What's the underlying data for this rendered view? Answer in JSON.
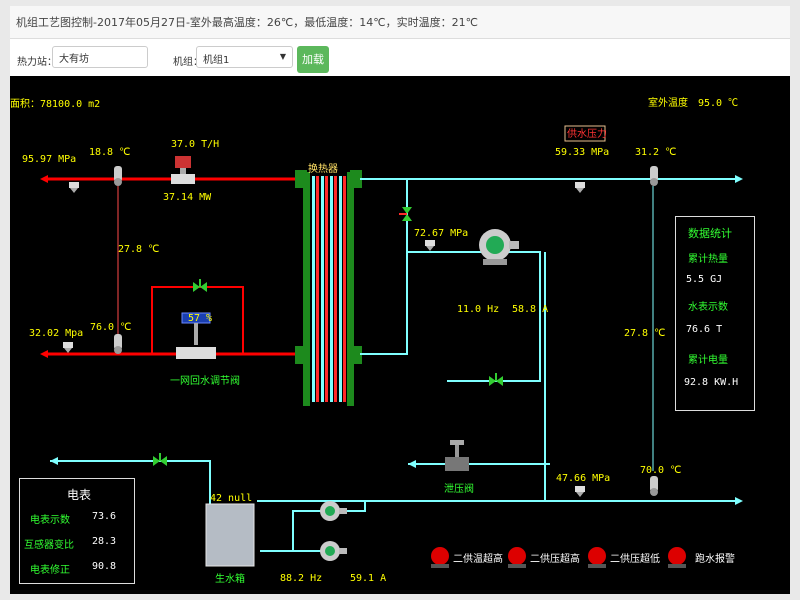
{
  "header": {
    "title": "机组工艺图控制-2017年05月27日-室外最高温度：26℃，最低温度：14℃，实时温度：21℃"
  },
  "toolbar": {
    "station_label": "热力站：",
    "station_value": "大有坊",
    "unit_label": "机组：",
    "unit_value": "机组1",
    "load_label": "加载"
  },
  "diagram": {
    "area": "面积：78100.0 m2",
    "outdoor_temp": "室外温度　95.0 ℃",
    "supply_pressure_badge": "供水压力",
    "heat_exchanger_label": "换热器",
    "primary_supply": {
      "pressure": "95.97 MPa",
      "temp": "18.8 ℃",
      "flow": "37.0 T/H",
      "power": "37.14 MW"
    },
    "primary_return": {
      "pressure": "32.02 Mpa",
      "temp": "76.0 ℃"
    },
    "bypass_temp": "27.8 ℃",
    "valve": {
      "open": "57 %",
      "label": "一网回水调节阀",
      "open_fraction": 0.57
    },
    "secondary_supply": {
      "pressure": "59.33 MPa",
      "temp": "31.2 ℃"
    },
    "secondary_mid_pressure": "72.67 MPa",
    "circ_pump": {
      "freq": "11.0 Hz",
      "current": "58.8 A"
    },
    "secondary_bypass_temp": "27.8 ℃",
    "pressure_relief_valve": "泄压阀",
    "secondary_return": {
      "pressure": "47.66 MPa",
      "temp": "70.0 ℃"
    },
    "tank": {
      "level": "42 null",
      "label": "生水箱"
    },
    "makeup_pump": {
      "freq": "88.2 Hz",
      "current": "59.1 A"
    },
    "alarms": [
      "二供温超高",
      "二供压超高",
      "二供压超低",
      "跑水报警"
    ]
  },
  "stats": {
    "title": "数据统计",
    "heat_label": "累计热量",
    "heat_value": "5.5 GJ",
    "water_label": "水表示数",
    "water_value": "76.6 T",
    "power_label": "累计电量",
    "power_value": "92.8 KW.H"
  },
  "meter": {
    "title": "电表",
    "reading_label": "电表示数",
    "reading_value": "73.6",
    "ct_label": "互感器变比",
    "ct_value": "28.3",
    "corr_label": "电表修正",
    "corr_value": "90.8"
  },
  "colors": {
    "hot_pipe": "#ff0000",
    "cold_pipe": "#7fffff",
    "value_text": "#ffff00",
    "label_text": "#32ff32",
    "load_button": "#5cb85c"
  },
  "icons": [
    "pressure-gauge-icon",
    "thermometer-icon",
    "flow-meter-icon",
    "pump-icon",
    "valve-icon",
    "alarm-light-icon"
  ]
}
